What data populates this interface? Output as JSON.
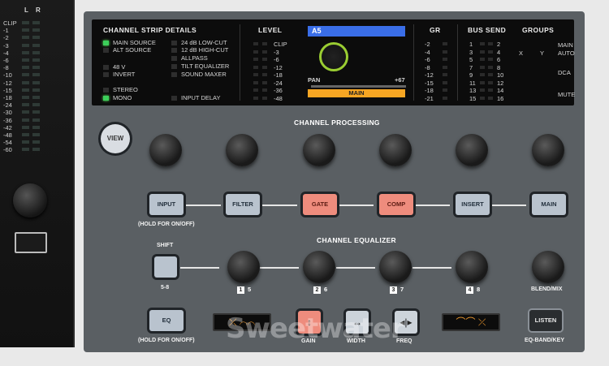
{
  "meter": {
    "header_l": "L",
    "header_r": "R",
    "scale": [
      "CLIP",
      "-1",
      "-2",
      "-3",
      "-4",
      "-6",
      "-8",
      "-10",
      "-12",
      "-15",
      "-18",
      "-24",
      "-30",
      "-36",
      "-42",
      "-48",
      "-54",
      "-60"
    ]
  },
  "lcd": {
    "strip_details_title": "CHANNEL STRIP DETAILS",
    "left_col": [
      "MAIN SOURCE",
      "ALT SOURCE",
      "48 V",
      "INVERT",
      "STEREO",
      "MONO"
    ],
    "right_col": [
      "24 dB LOW-CUT",
      "12 dB HIGH-CUT",
      "ALLPASS",
      "TILT EQUALIZER",
      "SOUND MAXER",
      "INPUT DELAY"
    ],
    "level_title": "LEVEL",
    "level_scale": [
      "CLIP",
      "-3",
      "-6",
      "-12",
      "-18",
      "-24",
      "-36",
      "-48"
    ],
    "channel_name": "A5",
    "pan_label": "PAN",
    "pan_value": "+67",
    "main_label": "MAIN",
    "gr_title": "GR",
    "gr_scale": [
      "-2",
      "-4",
      "-6",
      "-8",
      "-12",
      "-15",
      "-18",
      "-21"
    ],
    "bus_send_title": "BUS SEND",
    "bus_left": [
      "1",
      "3",
      "5",
      "7",
      "9",
      "11",
      "13",
      "15"
    ],
    "bus_right": [
      "2",
      "4",
      "6",
      "8",
      "10",
      "12",
      "14",
      "16"
    ],
    "groups_title": "GROUPS",
    "groups_labels": [
      "MAIN",
      "X",
      "Y",
      "AUTO",
      "DCA",
      "MUTE"
    ]
  },
  "controls": {
    "view": "VIEW",
    "channel_processing": "CHANNEL PROCESSING",
    "buttons": [
      "INPUT",
      "FILTER",
      "GATE",
      "COMP",
      "INSERT",
      "MAIN"
    ],
    "hold_input": "(HOLD FOR ON/OFF)",
    "channel_equalizer": "CHANNEL EQUALIZER",
    "shift": "SHIFT",
    "shift_sub": "5-8",
    "eq_nums": [
      "1",
      "2",
      "3",
      "4"
    ],
    "eq_subs": [
      "5",
      "6",
      "7",
      "8"
    ],
    "blend": "BLEND/MIX",
    "eq": "EQ",
    "hold_eq": "(HOLD FOR ON/OFF)",
    "gain": "GAIN",
    "width": "WIDTH",
    "freq": "FREQ",
    "listen": "LISTEN",
    "eq_band": "EQ-BAND/KEY"
  },
  "watermark": "Sweetwater"
}
